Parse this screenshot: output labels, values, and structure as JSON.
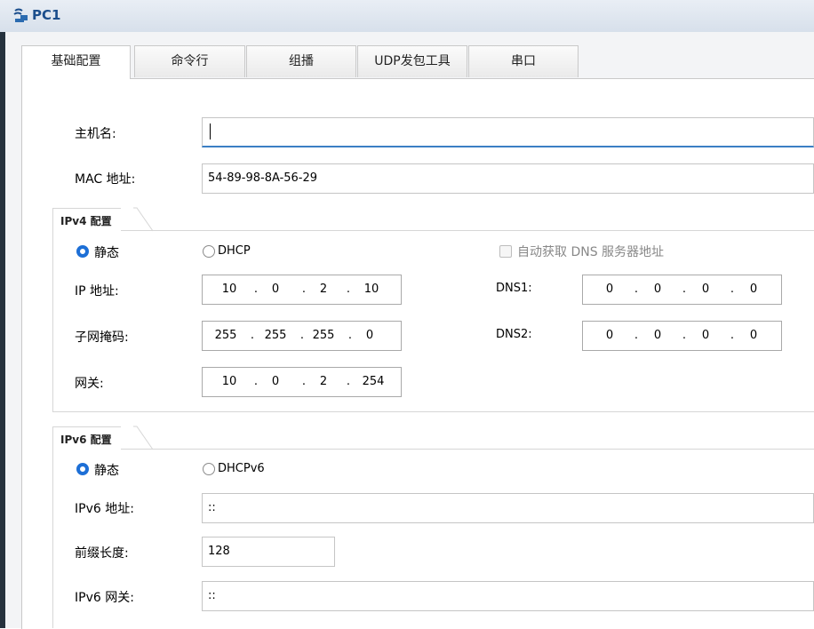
{
  "window": {
    "title": "PC1",
    "icon": "pc-network-icon"
  },
  "tabs": [
    {
      "label": "基础配置",
      "active": true
    },
    {
      "label": "命令行",
      "active": false
    },
    {
      "label": "组播",
      "active": false
    },
    {
      "label": "UDP发包工具",
      "active": false
    },
    {
      "label": "串口",
      "active": false
    }
  ],
  "basic": {
    "hostname_label": "主机名:",
    "hostname_value": "",
    "mac_label": "MAC 地址:",
    "mac_value": "54-89-98-8A-56-29"
  },
  "ipv4": {
    "title": "IPv4 配置",
    "static_label": "静态",
    "dhcp_label": "DHCP",
    "mode": "static",
    "auto_dns_label": "自动获取 DNS 服务器地址",
    "auto_dns_checked": false,
    "ip_label": "IP 地址:",
    "ip_octets": [
      "10",
      "0",
      "2",
      "10"
    ],
    "mask_label": "子网掩码:",
    "mask_octets": [
      "255",
      "255",
      "255",
      "0"
    ],
    "gateway_label": "网关:",
    "gateway_octets": [
      "10",
      "0",
      "2",
      "254"
    ],
    "dns1_label": "DNS1:",
    "dns1_octets": [
      "0",
      "0",
      "0",
      "0"
    ],
    "dns2_label": "DNS2:",
    "dns2_octets": [
      "0",
      "0",
      "0",
      "0"
    ]
  },
  "ipv6": {
    "title": "IPv6 配置",
    "static_label": "静态",
    "dhcp_label": "DHCPv6",
    "mode": "static",
    "address_label": "IPv6 地址:",
    "address_value": "::",
    "prefix_label": "前缀长度:",
    "prefix_value": "128",
    "gateway_label": "IPv6 网关:",
    "gateway_value": "::"
  },
  "colors": {
    "accent": "#1d6fd6",
    "title": "#1b4e8c",
    "frame": "#26323e"
  }
}
